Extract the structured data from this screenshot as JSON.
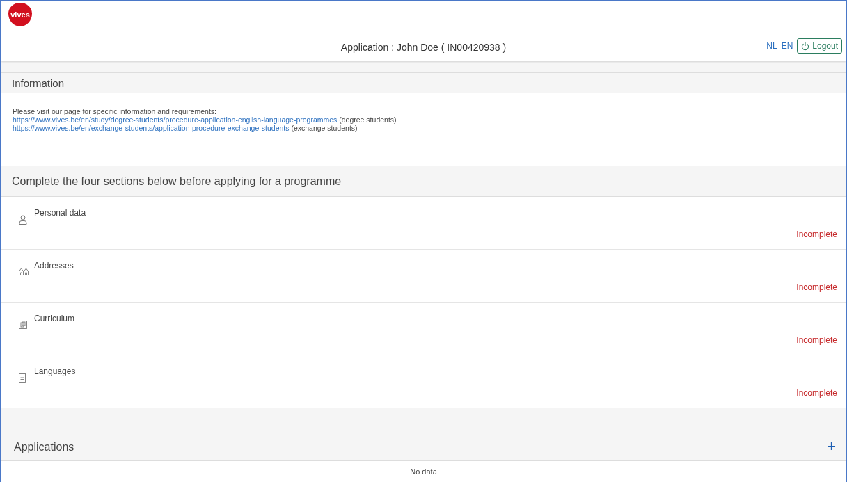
{
  "header": {
    "logo": "vives",
    "title": "Application : John Doe ( IN00420938 )",
    "languages": [
      {
        "label": "NL",
        "selected": false
      },
      {
        "label": "EN",
        "selected": false
      }
    ],
    "logout": "Logout"
  },
  "information": {
    "title": "Information",
    "intro": "Please visit our page for specific information and requirements:",
    "links": [
      {
        "url": "https://www.vives.be/en/study/degree-students/procedure-application-english-language-programmes",
        "note": "(degree students)"
      },
      {
        "url": "https://www.vives.be/en/exchange-students/application-procedure-exchange-students",
        "note": "(exchange students)"
      }
    ]
  },
  "sections_title": "Complete the four sections below before applying for a programme",
  "sections": [
    {
      "kind": "person",
      "label": "Personal data",
      "status": "Incomplete",
      "complete": false
    },
    {
      "kind": "houses",
      "label": "Addresses",
      "status": "Incomplete",
      "complete": false
    },
    {
      "kind": "documents",
      "label": "Curriculum",
      "status": "Incomplete",
      "complete": false
    },
    {
      "kind": "list",
      "label": "Languages",
      "status": "Incomplete",
      "complete": false
    }
  ],
  "applications": {
    "title": "Applications",
    "add": "+",
    "empty": "No data"
  }
}
